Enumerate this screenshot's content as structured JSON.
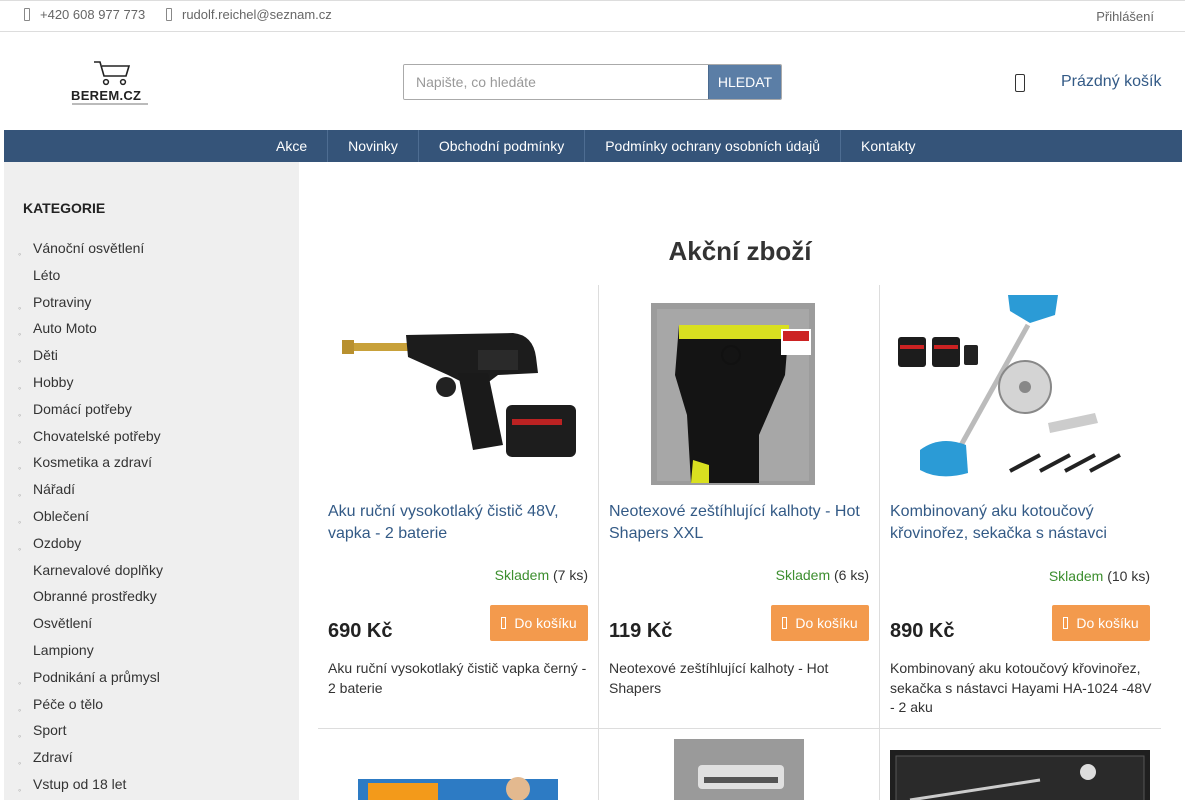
{
  "topbar": {
    "phone": "+420 608 977 773",
    "email": "rudolf.reichel@seznam.cz",
    "login": "Přihlášení"
  },
  "header": {
    "logo_text": "BEREM.CZ",
    "search_placeholder": "Napište, co hledáte",
    "search_button": "HLEDAT",
    "cart_label": "Prázdný košík"
  },
  "nav": [
    "Akce",
    "Novinky",
    "Obchodní podmínky",
    "Podmínky ochrany osobních údajů",
    "Kontakty"
  ],
  "sidebar": {
    "title": "KATEGORIE",
    "items": [
      {
        "label": "Vánoční osvětlení",
        "bullet": true
      },
      {
        "label": "Léto",
        "bullet": false
      },
      {
        "label": "Potraviny",
        "bullet": true
      },
      {
        "label": "Auto Moto",
        "bullet": true
      },
      {
        "label": "Děti",
        "bullet": true
      },
      {
        "label": "Hobby",
        "bullet": true
      },
      {
        "label": "Domácí potřeby",
        "bullet": true
      },
      {
        "label": "Chovatelské potřeby",
        "bullet": true
      },
      {
        "label": "Kosmetika a zdraví",
        "bullet": true
      },
      {
        "label": "Nářadí",
        "bullet": true
      },
      {
        "label": "Oblečení",
        "bullet": true
      },
      {
        "label": "Ozdoby",
        "bullet": true
      },
      {
        "label": "Karnevalové doplňky",
        "bullet": false
      },
      {
        "label": "Obranné prostředky",
        "bullet": false
      },
      {
        "label": "Osvětlení",
        "bullet": false
      },
      {
        "label": "Lampiony",
        "bullet": false
      },
      {
        "label": "Podnikání a průmysl",
        "bullet": true
      },
      {
        "label": "Péče o tělo",
        "bullet": true
      },
      {
        "label": "Sport",
        "bullet": true
      },
      {
        "label": "Zdraví",
        "bullet": true
      },
      {
        "label": "Vstup od 18 let",
        "bullet": true
      }
    ]
  },
  "main": {
    "title": "Akční zboží",
    "products": [
      {
        "name": "Aku ruční vysokotlaký čistič 48V, vapka - 2 baterie",
        "stock_status": "Skladem",
        "stock_count": "(7 ks)",
        "price": "690 Kč",
        "buy_label": "Do košíku",
        "description": "Aku ruční vysokotlaký čistič vapka černý - 2 baterie"
      },
      {
        "name": "Neotexové zeštíhlující kalhoty - Hot Shapers XXL",
        "stock_status": "Skladem",
        "stock_count": "(6 ks)",
        "price": "119 Kč",
        "buy_label": "Do košíku",
        "description": "Neotexové zeštíhlující kalhoty - Hot Shapers"
      },
      {
        "name": "Kombinovaný aku kotoučový křovinořez, sekačka s nástavci",
        "stock_status": "Skladem",
        "stock_count": "(10 ks)",
        "price": "890 Kč",
        "buy_label": "Do košíku",
        "description": "Kombinovaný aku kotoučový křovinořez, sekačka s nástavci Hayami HA-1024 -48V - 2 aku"
      }
    ]
  },
  "colors": {
    "nav_bg": "#355479",
    "link": "#335a86",
    "buy_button": "#f39a4d",
    "in_stock": "#3c8e2e",
    "search_button": "#5b7ea6"
  }
}
